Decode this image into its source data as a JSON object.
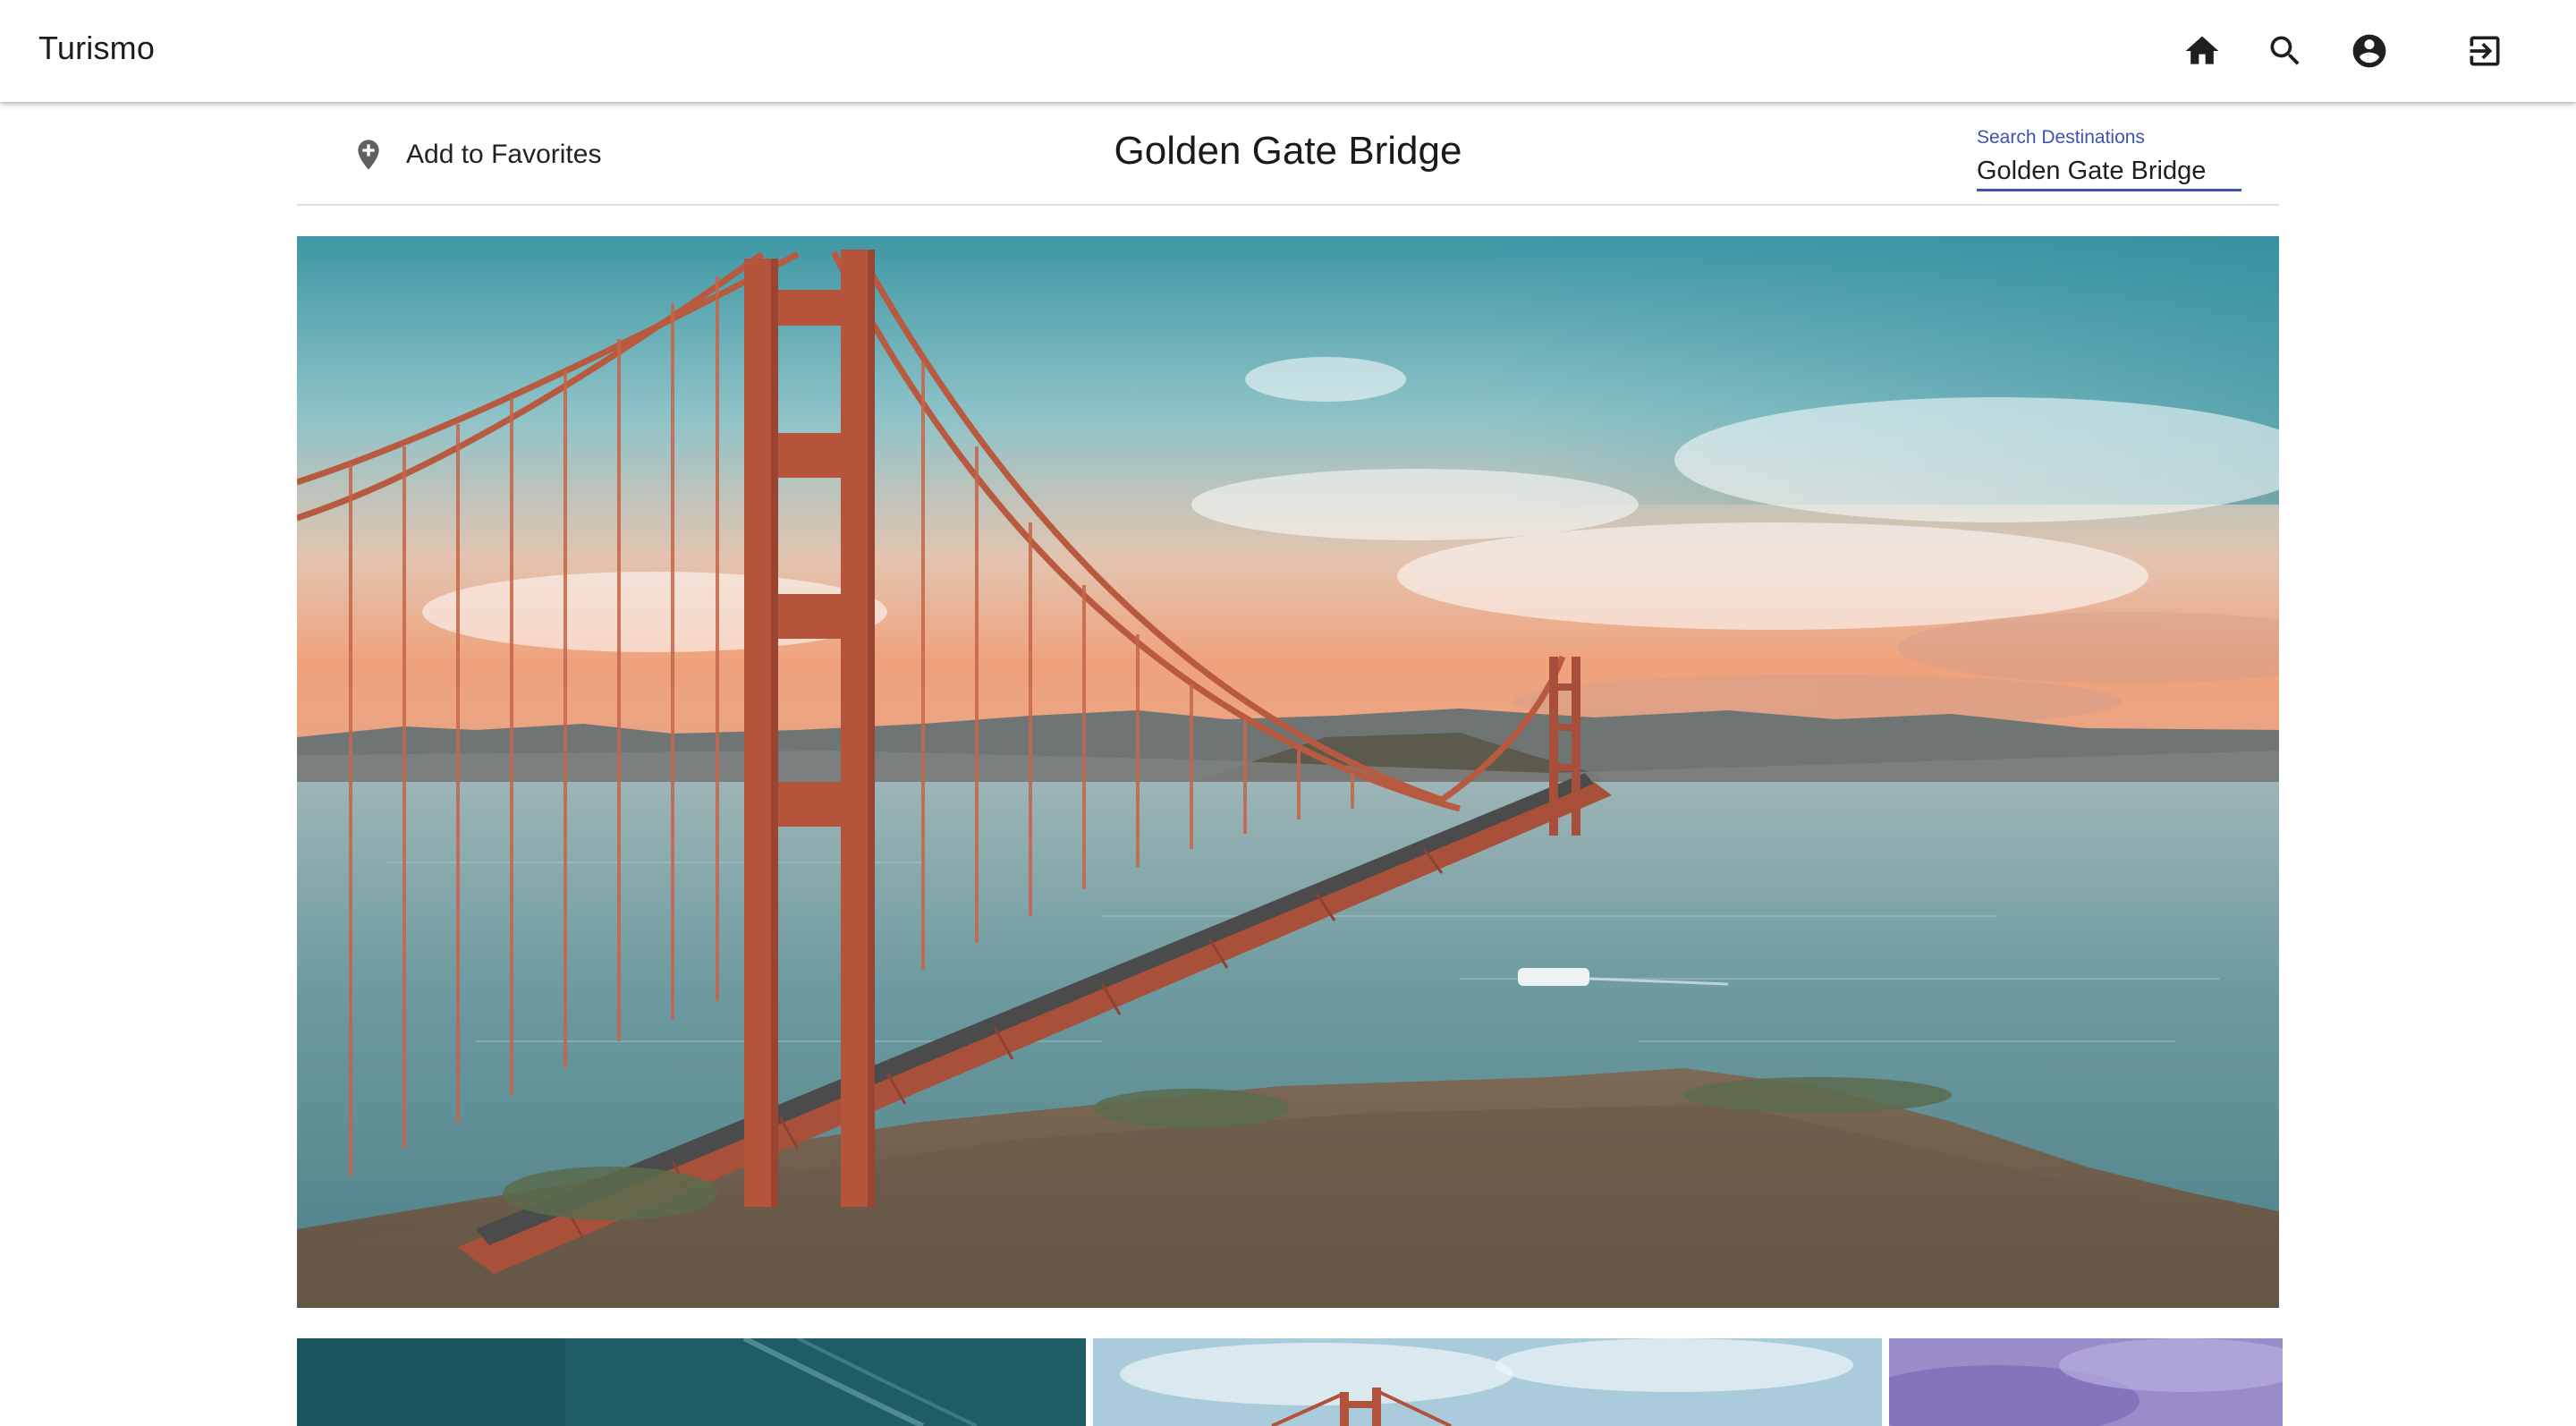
{
  "app": {
    "title": "Turismo"
  },
  "nav": {
    "home_icon": "home-icon",
    "search_icon": "search-icon",
    "account_icon": "account-circle-icon",
    "logout_icon": "exit-to-app-icon"
  },
  "subheader": {
    "favorite_icon": "add-location-icon",
    "favorite_label": "Add to Favorites",
    "destination_title": "Golden Gate Bridge"
  },
  "search": {
    "label": "Search Destinations",
    "value": "Golden Gate Bridge"
  },
  "colors": {
    "accent": "#3f51b5",
    "appbar_bg": "#ffffff",
    "bridge": "#c0583a",
    "sky": "#4fa3b0",
    "water": "#6f9fa6"
  }
}
